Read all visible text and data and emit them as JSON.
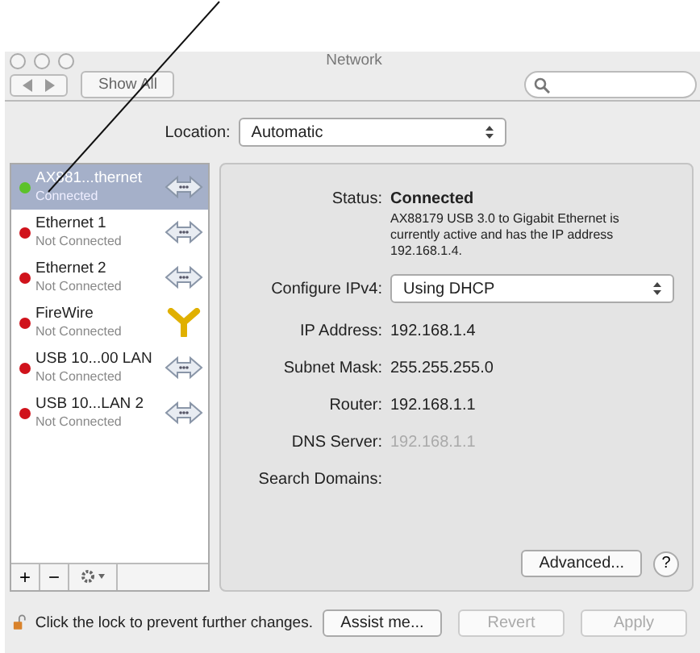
{
  "window": {
    "title": "Network"
  },
  "toolbar": {
    "show_all": "Show All"
  },
  "location": {
    "label": "Location:",
    "value": "Automatic"
  },
  "services": [
    {
      "name": "AX881...thernet",
      "status": "Connected",
      "color": "#5cc22a",
      "kind": "ethernet",
      "selected": true
    },
    {
      "name": "Ethernet 1",
      "status": "Not Connected",
      "color": "#d0121b",
      "kind": "ethernet",
      "selected": false
    },
    {
      "name": "Ethernet 2",
      "status": "Not Connected",
      "color": "#d0121b",
      "kind": "ethernet",
      "selected": false
    },
    {
      "name": "FireWire",
      "status": "Not Connected",
      "color": "#d0121b",
      "kind": "firewire",
      "selected": false
    },
    {
      "name": "USB 10...00 LAN",
      "status": "Not Connected",
      "color": "#d0121b",
      "kind": "ethernet",
      "selected": false
    },
    {
      "name": "USB 10...LAN 2",
      "status": "Not Connected",
      "color": "#d0121b",
      "kind": "ethernet",
      "selected": false
    }
  ],
  "list_buttons": [
    "+",
    "−"
  ],
  "details": {
    "status_label": "Status:",
    "status": "Connected",
    "status_note": "AX88179 USB 3.0 to Gigabit Ethernet is currently active and has the IP address 192.168.1.4.",
    "configure_label": "Configure IPv4:",
    "configure": "Using DHCP",
    "fields": [
      {
        "label": "IP Address:",
        "value": "192.168.1.4"
      },
      {
        "label": "Subnet Mask:",
        "value": "255.255.255.0"
      },
      {
        "label": "Router:",
        "value": "192.168.1.1"
      },
      {
        "label": "DNS Server:",
        "placeholder": "192.168.1.1"
      },
      {
        "label": "Search Domains:"
      }
    ],
    "advanced": "Advanced...",
    "help": "?"
  },
  "footer": {
    "lock_text": "Click the lock to prevent further changes.",
    "buttons": [
      {
        "label": "Assist me...",
        "disabled": false
      },
      {
        "label": "Revert",
        "disabled": true
      },
      {
        "label": "Apply",
        "disabled": true
      }
    ]
  }
}
